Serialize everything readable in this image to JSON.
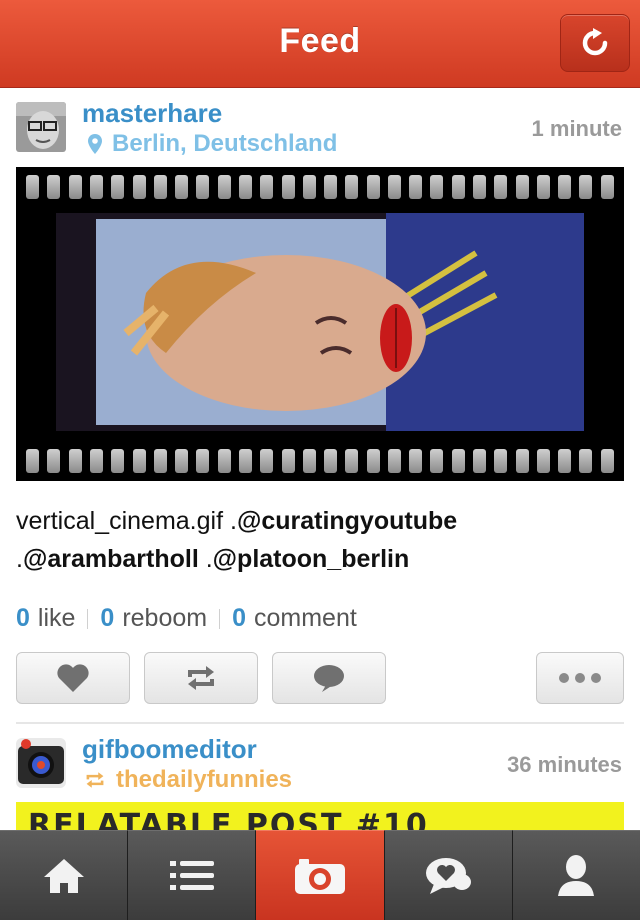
{
  "header": {
    "title": "Feed"
  },
  "posts": [
    {
      "username": "masterhare",
      "location": "Berlin, Deutschland",
      "time": "1 minute",
      "caption": {
        "text1": "vertical_cinema.gif .",
        "mention1": "@curatingyoutube",
        "text2": " .",
        "mention2": "@arambartholl",
        "text3": " .",
        "mention3": "@platoon_berlin"
      },
      "stats": {
        "likes_count": "0",
        "likes_label": "like",
        "reboom_count": "0",
        "reboom_label": "reboom",
        "comment_count": "0",
        "comment_label": "comment"
      }
    },
    {
      "username": "gifboomeditor",
      "reboomed_from": "thedailyfunnies",
      "time": "36 minutes",
      "media_text": "RELATABLE POST #10"
    }
  ],
  "colors": {
    "accent_red": "#d9432b",
    "link_blue": "#3a8fc8",
    "location_blue": "#7fc0e6",
    "reboom_orange": "#f0b35a",
    "banner_yellow": "#f2f21e"
  },
  "tabs": [
    "home-icon",
    "list-icon",
    "camera-icon",
    "chat-heart-icon",
    "profile-icon"
  ]
}
